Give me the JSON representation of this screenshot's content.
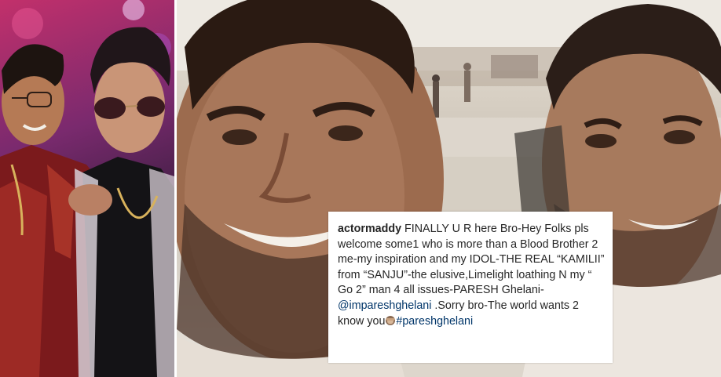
{
  "images": [
    {
      "name": "left-photo",
      "description_icon": "photo-two-men-party-icon"
    },
    {
      "name": "right-photo",
      "description_icon": "photo-selfie-icon"
    }
  ],
  "caption": {
    "username": "actormaddy",
    "text_part1": " FINALLY U R here Bro-Hey Folks pls welcome some1 who is more than a Blood Brother 2 me-my inspiration and my IDOL-THE REAL “KAMILII” from “SANJU”-the elusive,Limelight loathing N my “ Go 2” man 4 all issues-PARESH Ghelani-",
    "mention": "@impareshghelani",
    "text_part2": " .Sorry bro-The world wants 2 know you",
    "emoji_icon": "see-no-evil-monkey-icon",
    "hashtag": "#pareshghelani"
  },
  "colors": {
    "text": "#262626",
    "link": "#003569",
    "background": "#ffffff"
  }
}
